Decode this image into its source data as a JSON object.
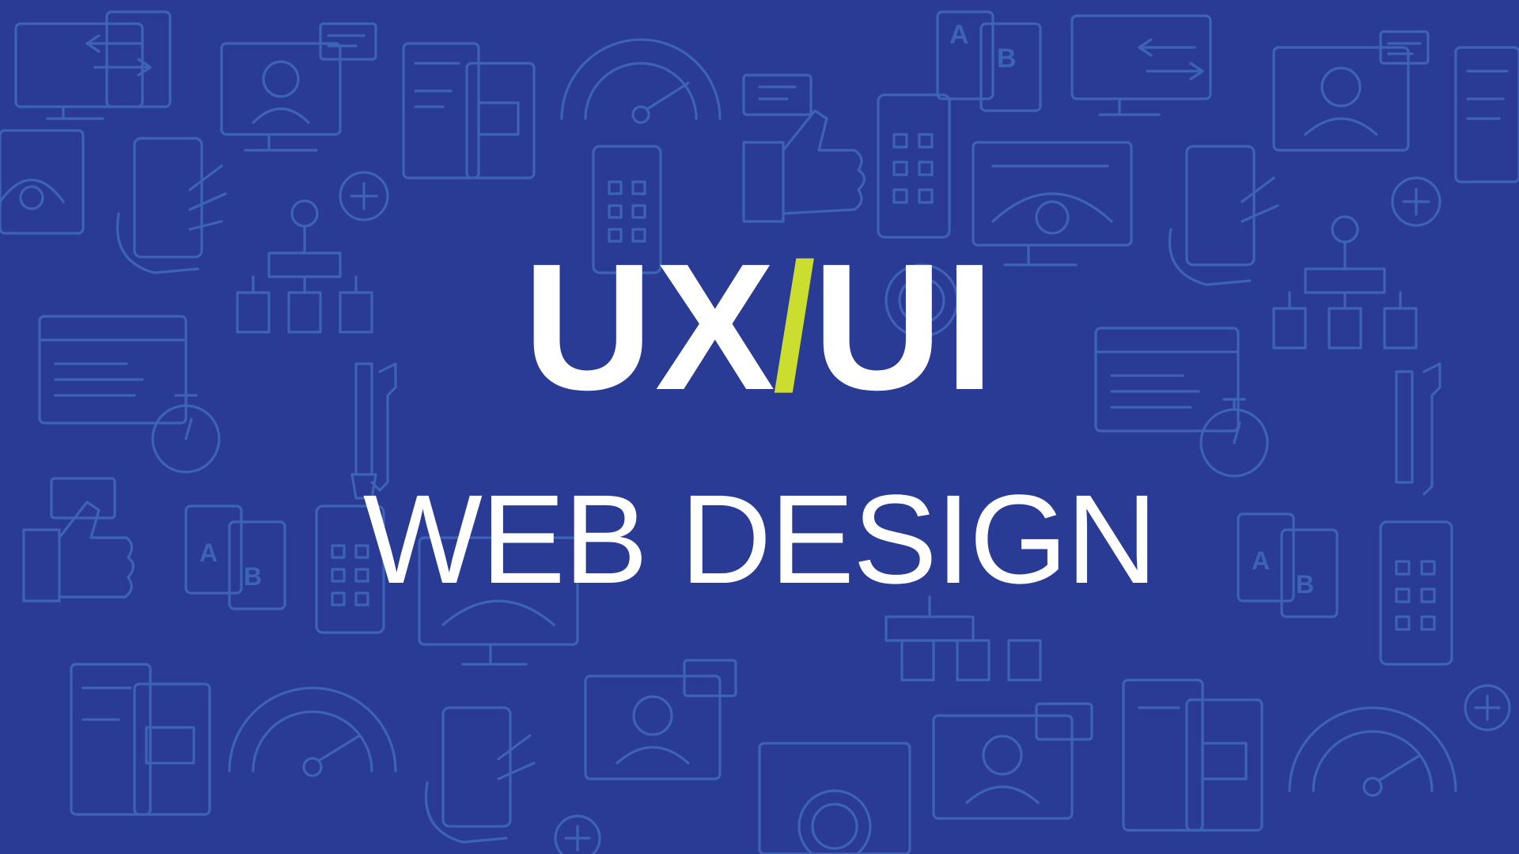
{
  "title": {
    "part1": "UX",
    "slash": "/",
    "part2": "UI"
  },
  "subtitle": "WEB DESIGN",
  "colors": {
    "background": "#2a3b96",
    "pattern": "#3d63b8",
    "text": "#ffffff",
    "accent": "#cbdd2f"
  },
  "pattern_icons": [
    "devices-sync-icon",
    "video-chat-icon",
    "wireframe-icon",
    "speedometer-icon",
    "thumbs-up-icon",
    "smartphone-app-icon",
    "monitor-gear-icon",
    "hand-phone-icon",
    "plus-circle-icon",
    "sitemap-icon",
    "browser-window-icon",
    "stopwatch-icon",
    "tools-icon",
    "touch-icon",
    "ab-test-icon"
  ]
}
